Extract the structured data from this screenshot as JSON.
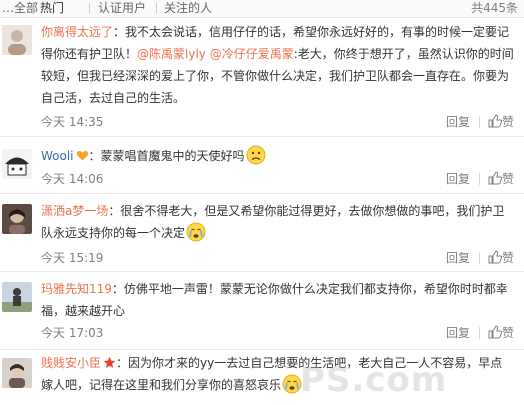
{
  "tabs": [
    "…全部",
    "热门",
    "认证用户",
    "关注的人"
  ],
  "total_count": "共445条",
  "actions": {
    "reply": "回复",
    "like": "赞"
  },
  "colors": {
    "username": "#eb7350",
    "username_alt": "#3a6ea5",
    "meta": "#808080",
    "text": "#333333"
  },
  "comments": [
    {
      "username": "你离得太远了",
      "separator": "：",
      "text_a": "我不太会说话，信用仔仔的话，希望你永远好好的，有事的时候一定要记得你还有护卫队！",
      "mention_a": "@陈禹蒙lyly",
      "mention_b": "@冷仔仔爱禹蒙",
      "text_b": ":老大，你终于想开了，虽然认识你的时间较短，但我已经深深的爱上了你，不管你做什么决定，我们护卫队都会一直存在。你要为自己活，去过自己的生活。",
      "time": "今天 14:35",
      "avatar_icon": "avatar-user-icon"
    },
    {
      "username": "Wooli",
      "badge_icon": "heart-badge-icon",
      "separator": "：",
      "text": "蒙蒙唱首魔鬼中的天使好吗",
      "emoji": "sad-face-icon",
      "time": "今天 14:06",
      "avatar_icon": "avatar-user-icon"
    },
    {
      "username": "潇洒a梦一场",
      "separator": "：",
      "text": "很舍不得老大，但是又希望你能过得更好，去做你想做的事吧，我们护卫队永远支持你的每一个决定",
      "emoji": "crying-face-icon",
      "time": "今天 15:19",
      "avatar_icon": "avatar-user-icon"
    },
    {
      "username": "玛雅先知119",
      "separator": "：",
      "text": "仿佛平地一声雷！蒙蒙无论你做什么决定我们都支持你，希望你时时都幸福，越来越开心",
      "time": "今天 17:03",
      "avatar_icon": "avatar-user-icon"
    },
    {
      "username": "贱贱安小臣",
      "badge_icon": "star-badge-icon",
      "separator": "：",
      "text": "因为你才来的yy一去过自己想要的生活吧，老大自己一人不容易，早点嫁人吧，记得在这里和我们分享你的喜怒哀乐",
      "emoji": "crying-face-icon",
      "avatar_icon": "avatar-user-icon"
    }
  ],
  "watermark": "PS.com"
}
